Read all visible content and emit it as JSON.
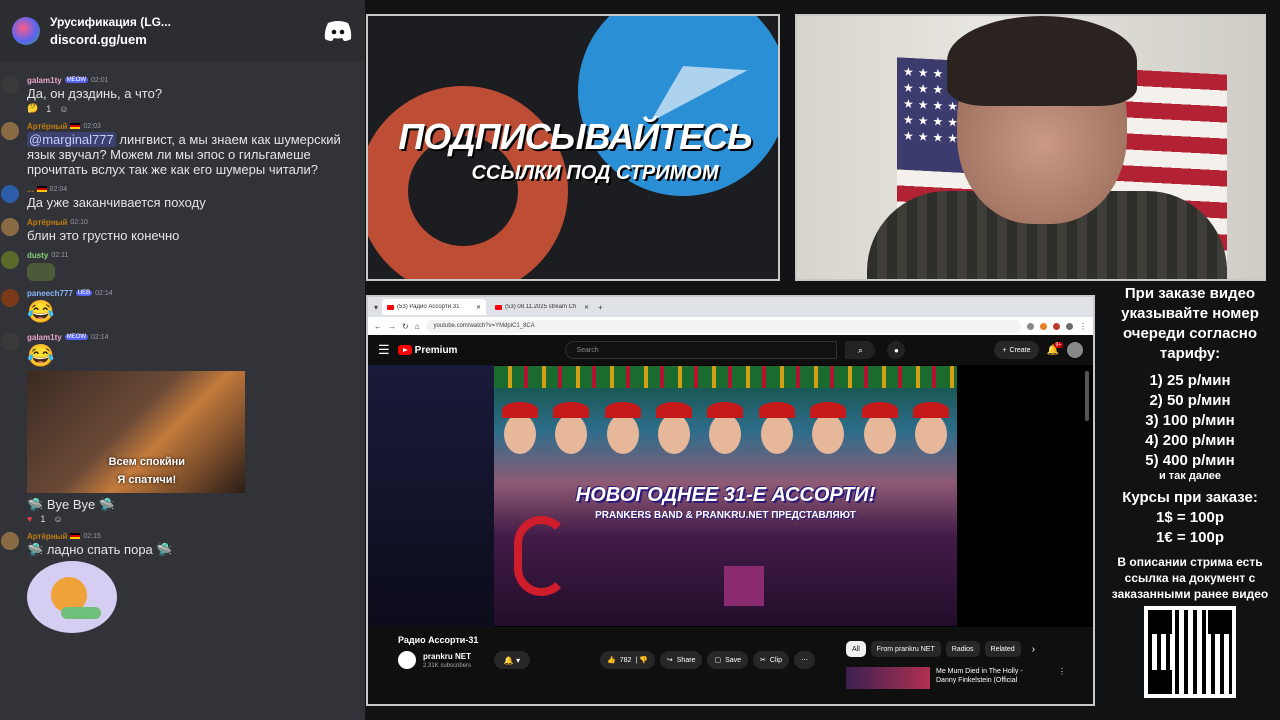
{
  "server": {
    "name": "Урусификация (LG...",
    "link": "discord.gg/uem"
  },
  "messages": [
    {
      "user": "galam1ty",
      "badge": "MEOW",
      "time": "02:01",
      "text": "Да, он дэздинь, а что?",
      "reaction_count": "1"
    },
    {
      "user": "Артёрный",
      "time": "02:03",
      "mention": "@marginal777",
      "text": " лингвист, а мы знаем как шумерский язык звучал? Можем ли мы эпос о гильгамеше прочитать вслух так же как его шумеры читали?"
    },
    {
      "user": "...",
      "time": "02:04",
      "text": "Да уже заканчивается походу"
    },
    {
      "user": "Артёрный",
      "time": "02:10",
      "text": "блин это грустно конечно"
    },
    {
      "user": "dusty",
      "time": "02:11",
      "text": ""
    },
    {
      "user": "paneech777",
      "badge": "UEB",
      "time": "02:14",
      "text": "😂"
    },
    {
      "user": "galam1ty",
      "badge": "MEOW",
      "time": "02:14",
      "text": "😂",
      "video_caption_1": "Всем спокйни",
      "video_caption_2": "Я спатичи!",
      "after_text": "Bye Bye",
      "reaction_count": "1"
    },
    {
      "user": "Артёрный",
      "time": "02:15",
      "text": "ладно спать пора"
    }
  ],
  "promo": {
    "title": "ПОДПИСЫВАЙТЕСЬ",
    "subtitle": "ССЫЛКИ ПОД СТРИМОМ"
  },
  "browser": {
    "tab1": "(53) Радио Ассорти 31",
    "tab2": "(53) 08.11.2025 stream Ch",
    "url": "youtube.com/watch?v=YMdpiC1_8CA",
    "yt_brand": "Premium",
    "search_placeholder": "Search",
    "create": "Create",
    "bell_badge": "9+",
    "thumb_title": "НОВОГОДНЕЕ 31-Е АССОРТИ!",
    "thumb_sub": "PRANKERS BAND & PRANKRU.NET ПРЕДСТАВЛЯЮТ",
    "video_title": "Радио Ассорти-31",
    "channel_name": "prankru NET",
    "channel_subs": "2.31K subscribers",
    "likes": "782",
    "share": "Share",
    "save": "Save",
    "clip": "Clip",
    "chips": [
      "All",
      "From prankru NET",
      "Radios",
      "Related"
    ],
    "rec_title_1": "Me Mum Died in The Holly -",
    "rec_title_2": "Danny Finkelstein (Official"
  },
  "info": {
    "head": "При заказе видео указывайте номер очереди согласно тарифу:",
    "tariffs": [
      "1) 25 р/мин",
      "2) 50 р/мин",
      "3) 100 р/мин",
      "4) 200 р/мин",
      "5) 400 р/мин"
    ],
    "more": "и так далее",
    "courses_title": "Курсы при заказе:",
    "rates": [
      "1$ = 100р",
      "1€ = 100р"
    ],
    "desc": "В описании стрима есть ссылка на документ с заказанными ранее видео"
  },
  "colors": {
    "chat_bg": "#313338",
    "header_bg": "#2b2d31",
    "page_bg": "#111214",
    "accent": "#5865f2",
    "youtube_red": "#ff0000"
  }
}
